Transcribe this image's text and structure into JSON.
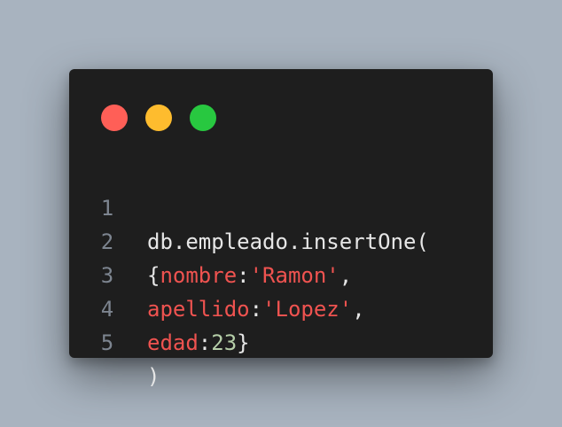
{
  "window": {
    "controls": [
      {
        "name": "close",
        "color": "#ff5f57"
      },
      {
        "name": "minimize",
        "color": "#febc2e"
      },
      {
        "name": "maximize",
        "color": "#28c840"
      }
    ]
  },
  "code": {
    "lines": [
      {
        "number": "1",
        "t1": "db.empleado.insertOne("
      },
      {
        "number": "2",
        "t1": "{",
        "t2": "nombre",
        "t3": ":",
        "t4": "'Ramon'",
        "t5": ","
      },
      {
        "number": "3",
        "t1": "apellido",
        "t2": ":",
        "t3": "'Lopez'",
        "t4": ","
      },
      {
        "number": "4",
        "t1": "edad",
        "t2": ":",
        "t3": "23",
        "t4": "}"
      },
      {
        "number": "5",
        "t1": ")"
      }
    ]
  },
  "colors": {
    "background": "#a8b3bf",
    "editor": "#1e1e1e",
    "keyword": "#ef5350",
    "number": "#b5cea8",
    "text": "#e6e6e6",
    "line_number": "#7d8590"
  }
}
